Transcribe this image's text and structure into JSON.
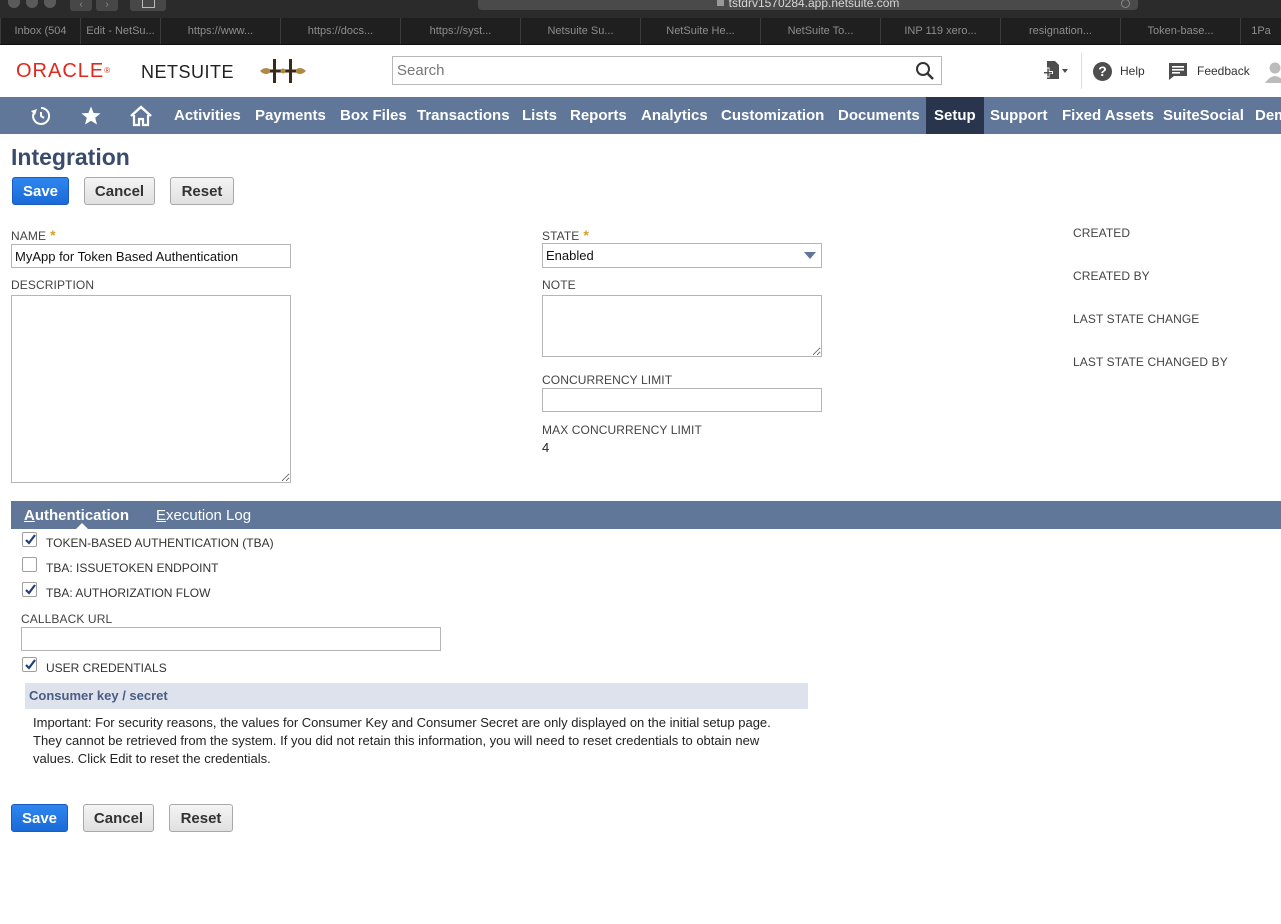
{
  "browser": {
    "url": "tstdrv1570284.app.netsuite.com",
    "tabs": [
      "Inbox (504",
      "Edit - NetSu...",
      "https://www...",
      "https://docs...",
      "https://syst...",
      "Netsuite Su...",
      "NetSuite He...",
      "NetSuite To...",
      "INP 119 xero...",
      "resignation...",
      "Token-base...",
      "1Pa"
    ]
  },
  "header": {
    "logo_oracle": "ORACLE",
    "logo_netsuite": "NETSUITE",
    "search_placeholder": "Search",
    "help_label": "Help",
    "feedback_label": "Feedback"
  },
  "nav": {
    "items": [
      "Activities",
      "Payments",
      "Box Files",
      "Transactions",
      "Lists",
      "Reports",
      "Analytics",
      "Customization",
      "Documents",
      "Setup",
      "Support",
      "Fixed Assets",
      "SuiteSocial",
      "Dem"
    ],
    "active": "Setup"
  },
  "page": {
    "title": "Integration",
    "save_label": "Save",
    "cancel_label": "Cancel",
    "reset_label": "Reset"
  },
  "form": {
    "name_label": "NAME",
    "name_value": "MyApp for Token Based Authentication",
    "description_label": "DESCRIPTION",
    "state_label": "STATE",
    "state_value": "Enabled",
    "note_label": "NOTE",
    "concurrency_label": "CONCURRENCY LIMIT",
    "max_concurrency_label": "MAX CONCURRENCY LIMIT",
    "max_concurrency_value": "4",
    "required_mark": "*",
    "created_label": "CREATED",
    "created_by_label": "CREATED BY",
    "last_state_change_label": "LAST STATE CHANGE",
    "last_state_changed_by_label": "LAST STATE CHANGED BY"
  },
  "subtabs": {
    "authentication": {
      "first": "A",
      "rest": "uthentication"
    },
    "execution_log": {
      "first": "E",
      "rest": "xecution Log"
    }
  },
  "auth": {
    "tba_label": "TOKEN-BASED AUTHENTICATION (TBA)",
    "tba_checked": true,
    "issuetoken_label": "TBA: ISSUETOKEN ENDPOINT",
    "issuetoken_checked": false,
    "authflow_label": "TBA: AUTHORIZATION FLOW",
    "authflow_checked": true,
    "callback_label": "CALLBACK URL",
    "user_credentials_label": "USER CREDENTIALS",
    "user_credentials_checked": true,
    "section_title": "Consumer key / secret",
    "notice": "Important: For security reasons, the values for Consumer Key and Consumer Secret are only displayed on the initial setup page. They cannot be retrieved from the system. If you did not retain this information, you will need to reset credentials to obtain new values. Click Edit to reset the credentials."
  },
  "colors": {
    "nav_bg": "#607799",
    "nav_active": "#28354d",
    "title": "#3a4c6c",
    "primary_button": "#1a6ad8",
    "oracle_red": "#e4271b"
  }
}
